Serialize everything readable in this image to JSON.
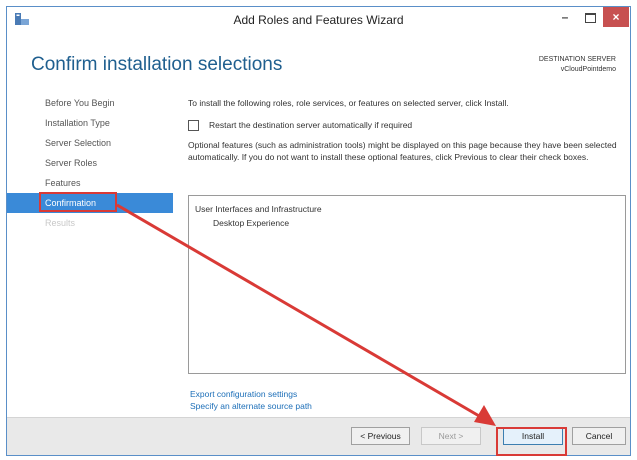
{
  "window": {
    "title": "Add Roles and Features Wizard",
    "minimize_glyph": "–",
    "close_glyph": "×"
  },
  "header": {
    "title": "Confirm installation selections",
    "destination_label": "DESTINATION SERVER",
    "destination_value": "vCloudPointdemo"
  },
  "nav": {
    "items": [
      {
        "label": "Before You Begin",
        "state": "normal"
      },
      {
        "label": "Installation Type",
        "state": "normal"
      },
      {
        "label": "Server Selection",
        "state": "normal"
      },
      {
        "label": "Server Roles",
        "state": "normal"
      },
      {
        "label": "Features",
        "state": "normal"
      },
      {
        "label": "Confirmation",
        "state": "active"
      },
      {
        "label": "Results",
        "state": "disabled"
      }
    ]
  },
  "main": {
    "intro": "To install the following roles, role services, or features on selected server, click Install.",
    "restart_label": "Restart the destination server automatically if required",
    "restart_checked": false,
    "optional_text": "Optional features (such as administration tools) might be displayed on this page because they have been selected automatically. If you do not want to install these optional features, click Previous to clear their check boxes.",
    "list": [
      {
        "label": "User Interfaces and Infrastructure",
        "level": 0
      },
      {
        "label": "Desktop Experience",
        "level": 1
      }
    ],
    "export_link": "Export configuration settings",
    "alternate_link": "Specify an alternate source path"
  },
  "footer": {
    "previous_label": "< Previous",
    "next_label": "Next >",
    "install_label": "Install",
    "cancel_label": "Cancel"
  },
  "colors": {
    "accent": "#3a8ad8",
    "title_blue": "#1f5f8f",
    "annotation_red": "#d93a36",
    "link_blue": "#1d6fb8"
  },
  "icons": {
    "app": "server-manager-icon",
    "minimize": "minimize-icon",
    "maximize": "maximize-icon",
    "close": "close-icon"
  }
}
